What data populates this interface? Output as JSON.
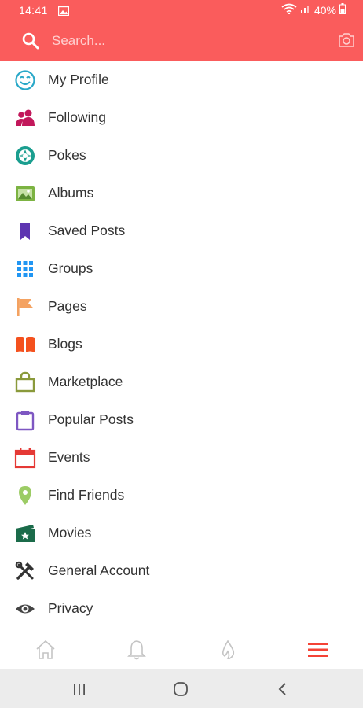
{
  "status_bar": {
    "time": "14:41",
    "battery": "40%",
    "icons": [
      "gallery-icon",
      "wifi-icon",
      "signal-icon",
      "battery-icon"
    ]
  },
  "search": {
    "placeholder": "Search...",
    "icons": [
      "search-icon",
      "camera-icon"
    ]
  },
  "menu": {
    "items": [
      {
        "label": "My Profile",
        "icon": "smiley-icon",
        "color": "#29a8c8"
      },
      {
        "label": "Following",
        "icon": "people-icon",
        "color": "#c2185b"
      },
      {
        "label": "Pokes",
        "icon": "aperture-icon",
        "color": "#1a9e8f"
      },
      {
        "label": "Albums",
        "icon": "image-icon",
        "color": "#7cb342"
      },
      {
        "label": "Saved Posts",
        "icon": "bookmark-icon",
        "color": "#5e35b1"
      },
      {
        "label": "Groups",
        "icon": "grid-icon",
        "color": "#2196f3"
      },
      {
        "label": "Pages",
        "icon": "flag-icon",
        "color": "#f4a261"
      },
      {
        "label": "Blogs",
        "icon": "book-icon",
        "color": "#f4511e"
      },
      {
        "label": "Marketplace",
        "icon": "bag-icon",
        "color": "#8a9a3b"
      },
      {
        "label": "Popular Posts",
        "icon": "clipboard-icon",
        "color": "#7e57c2"
      },
      {
        "label": "Events",
        "icon": "calendar-icon",
        "color": "#e53935"
      },
      {
        "label": "Find Friends",
        "icon": "location-pin-icon",
        "color": "#9ccc65"
      },
      {
        "label": "Movies",
        "icon": "film-icon",
        "color": "#1b6b4a"
      },
      {
        "label": "General Account",
        "icon": "tools-icon",
        "color": "#333333"
      },
      {
        "label": "Privacy",
        "icon": "eye-icon",
        "color": "#444444"
      }
    ]
  },
  "bottom_nav": {
    "items": [
      "home-icon",
      "bell-icon",
      "flame-icon",
      "menu-icon"
    ],
    "active": "menu-icon",
    "active_color": "#f44336"
  },
  "system_nav": {
    "items": [
      "recents-icon",
      "home-circle-icon",
      "back-icon"
    ]
  },
  "colors": {
    "header": "#fa5c5c",
    "text": "#333333"
  }
}
